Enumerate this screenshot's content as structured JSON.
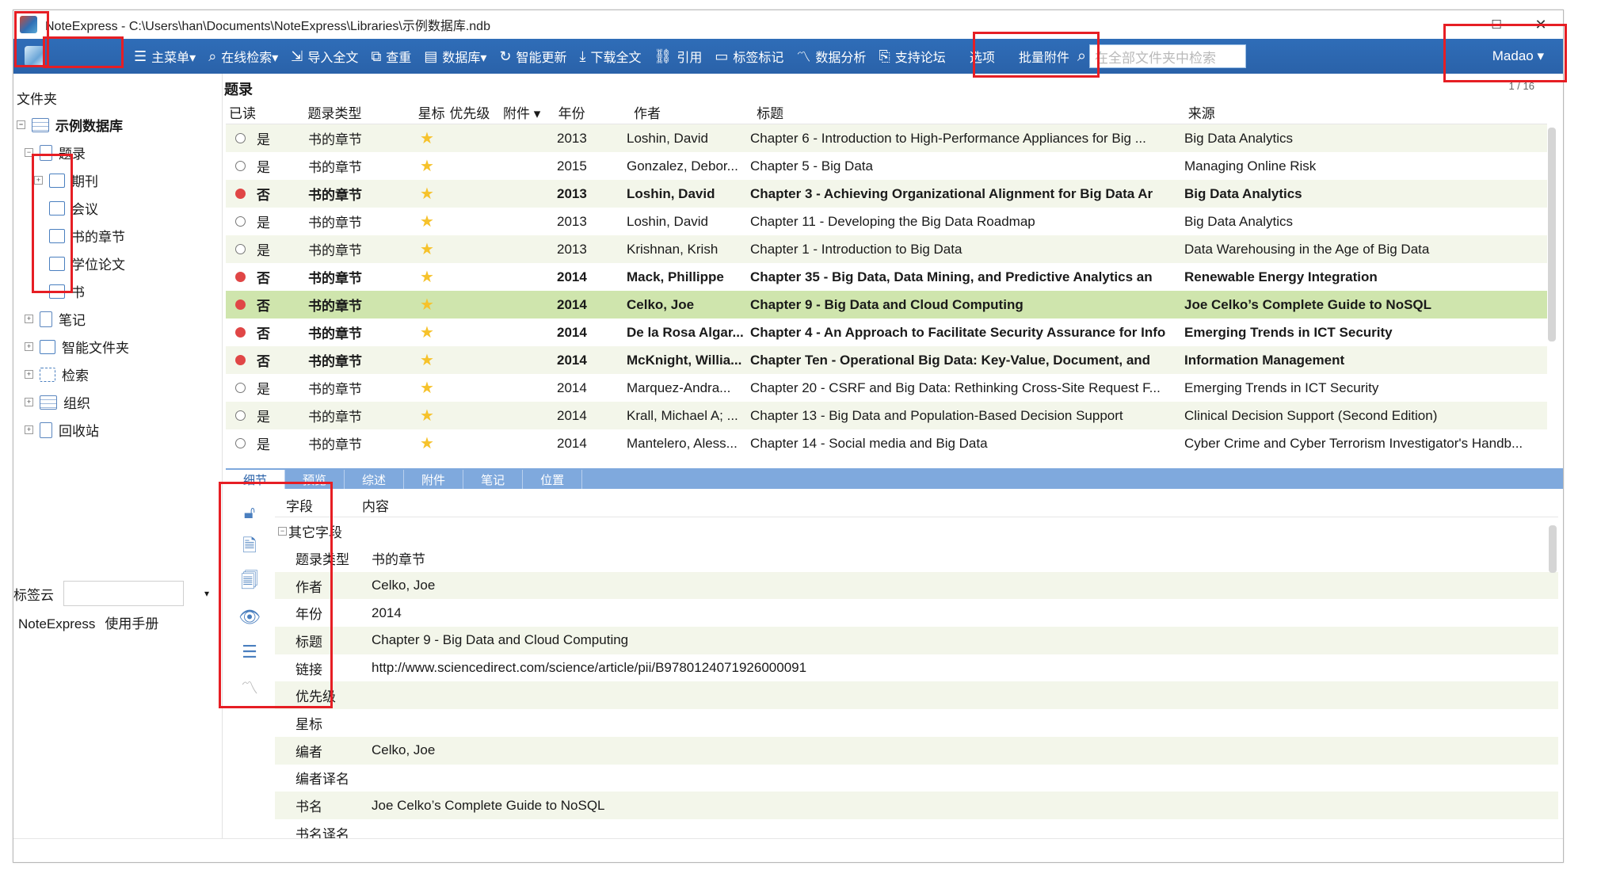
{
  "window": {
    "title": "NoteExpress - C:\\Users\\han\\Documents\\NoteExpress\\Libraries\\示例数据库.ndb",
    "minimize": "—",
    "maximize": "☐",
    "close": "✕"
  },
  "toolbar": {
    "items": [
      {
        "icon": "☰",
        "label": "主菜单▾"
      },
      {
        "icon": "⌕",
        "label": "在线检索▾"
      },
      {
        "icon": "⇲",
        "label": "导入全文"
      },
      {
        "icon": "⧉",
        "label": "查重"
      },
      {
        "icon": "▤",
        "label": "数据库▾"
      },
      {
        "icon": "↻",
        "label": "智能更新"
      },
      {
        "icon": "⤓",
        "label": "下载全文"
      },
      {
        "icon": "⛓",
        "label": "引用"
      },
      {
        "icon": "▭",
        "label": "标签标记"
      },
      {
        "icon": "〽",
        "label": "数据分析"
      },
      {
        "icon": "⎘",
        "label": "支持论坛"
      },
      {
        "icon": "",
        "label": "选项"
      },
      {
        "icon": "",
        "label": "批量附件"
      }
    ],
    "search_placeholder": "在全部文件夹中检索",
    "user": "Madao ▾"
  },
  "left": {
    "header": "文件夹",
    "db_name": "示例数据库",
    "tree": [
      {
        "label": "题录",
        "level": 1
      },
      {
        "label": "期刊",
        "level": 2
      },
      {
        "label": "会议",
        "level": 2
      },
      {
        "label": "书的章节",
        "level": 2
      },
      {
        "label": "学位论文",
        "level": 2
      },
      {
        "label": "书",
        "level": 2
      },
      {
        "label": "笔记",
        "level": 1
      },
      {
        "label": "智能文件夹",
        "level": 1
      },
      {
        "label": "检索",
        "level": 1
      },
      {
        "label": "组织",
        "level": 1
      },
      {
        "label": "回收站",
        "level": 1
      }
    ],
    "tag_cloud": "标签云",
    "links": [
      "NoteExpress",
      "使用手册"
    ]
  },
  "main": {
    "title": "题录",
    "pager": "1 / 16",
    "columns": [
      "已读",
      "题录类型",
      "星标",
      "优先级",
      "附件 ▾",
      "年份",
      "作者",
      "标题",
      "来源"
    ],
    "rows": [
      {
        "read": false,
        "read_label": "是",
        "type": "书的章节",
        "year": "2013",
        "author": "Loshin, David",
        "title": "Chapter 6 - Introduction to High-Performance Appliances for Big ...",
        "source": "Big Data Analytics",
        "bold": false
      },
      {
        "read": false,
        "read_label": "是",
        "type": "书的章节",
        "year": "2015",
        "author": "Gonzalez, Debor...",
        "title": "Chapter 5 - Big Data",
        "source": "Managing Online Risk",
        "bold": false
      },
      {
        "read": true,
        "read_label": "否",
        "type": "书的章节",
        "year": "2013",
        "author": "Loshin, David",
        "title": "Chapter 3 - Achieving Organizational Alignment for Big Data Ar",
        "source": "Big Data Analytics",
        "bold": true
      },
      {
        "read": false,
        "read_label": "是",
        "type": "书的章节",
        "year": "2013",
        "author": "Loshin, David",
        "title": "Chapter 11 - Developing the Big Data Roadmap",
        "source": "Big Data Analytics",
        "bold": false
      },
      {
        "read": false,
        "read_label": "是",
        "type": "书的章节",
        "year": "2013",
        "author": "Krishnan, Krish",
        "title": "Chapter 1 - Introduction to Big Data",
        "source": "Data Warehousing in the Age of Big Data",
        "bold": false
      },
      {
        "read": true,
        "read_label": "否",
        "type": "书的章节",
        "year": "2014",
        "author": "Mack, Phillippe",
        "title": "Chapter 35 - Big Data, Data Mining, and Predictive Analytics an",
        "source": "Renewable Energy Integration",
        "bold": true
      },
      {
        "read": true,
        "read_label": "否",
        "type": "书的章节",
        "year": "2014",
        "author": "Celko, Joe",
        "title": "Chapter 9 - Big Data and Cloud Computing",
        "source": "Joe Celko’s Complete Guide to NoSQL",
        "bold": true,
        "selected": true
      },
      {
        "read": true,
        "read_label": "否",
        "type": "书的章节",
        "year": "2014",
        "author": "De la Rosa Algar...",
        "title": "Chapter 4 - An Approach to Facilitate Security Assurance for Info",
        "source": "Emerging Trends in ICT Security",
        "bold": true
      },
      {
        "read": true,
        "read_label": "否",
        "type": "书的章节",
        "year": "2014",
        "author": "McKnight, Willia...",
        "title": "Chapter Ten - Operational Big Data: Key-Value, Document, and",
        "source": "Information Management",
        "bold": true
      },
      {
        "read": false,
        "read_label": "是",
        "type": "书的章节",
        "year": "2014",
        "author": "Marquez-Andra...",
        "title": "Chapter 20 - CSRF and Big Data: Rethinking Cross-Site Request F...",
        "source": "Emerging Trends in ICT Security",
        "bold": false
      },
      {
        "read": false,
        "read_label": "是",
        "type": "书的章节",
        "year": "2014",
        "author": "Krall, Michael A; ...",
        "title": "Chapter 13 - Big Data and Population-Based Decision Support",
        "source": "Clinical Decision Support (Second Edition)",
        "bold": false
      },
      {
        "read": false,
        "read_label": "是",
        "type": "书的章节",
        "year": "2014",
        "author": "Mantelero, Aless...",
        "title": "Chapter 14 - Social media and Big Data",
        "source": "Cyber Crime and Cyber Terrorism Investigator's Handb...",
        "bold": false
      }
    ]
  },
  "detail": {
    "tabs": [
      "细节",
      "预览",
      "综述",
      "附件",
      "笔记",
      "位置"
    ],
    "headers": [
      "字段",
      "内容"
    ],
    "group": "其它字段",
    "fields": [
      {
        "name": "题录类型",
        "value": "书的章节"
      },
      {
        "name": "作者",
        "value": "Celko, Joe"
      },
      {
        "name": "年份",
        "value": "2014"
      },
      {
        "name": "标题",
        "value": "Chapter 9 - Big Data and Cloud Computing"
      },
      {
        "name": "链接",
        "value": "http://www.sciencedirect.com/science/article/pii/B9780124071926000091"
      },
      {
        "name": "优先级",
        "value": ""
      },
      {
        "name": "星标",
        "value": ""
      },
      {
        "name": "编者",
        "value": "Celko, Joe"
      },
      {
        "name": "编者译名",
        "value": ""
      },
      {
        "name": "书名",
        "value": "Joe Celko’s Complete Guide to NoSQL"
      },
      {
        "name": "书名译名",
        "value": ""
      }
    ],
    "side_icons": [
      "lock-icon",
      "document-icon",
      "pages-icon",
      "eye-icon",
      "list-icon",
      "chart-icon"
    ]
  },
  "colors": {
    "toolbar": "#2a62a9",
    "selected_row": "#cfe5ad",
    "alt_row": "#f3f6ea",
    "unread_dot": "#e04646",
    "star": "#f6c22b",
    "annotation": "#e61e24"
  }
}
